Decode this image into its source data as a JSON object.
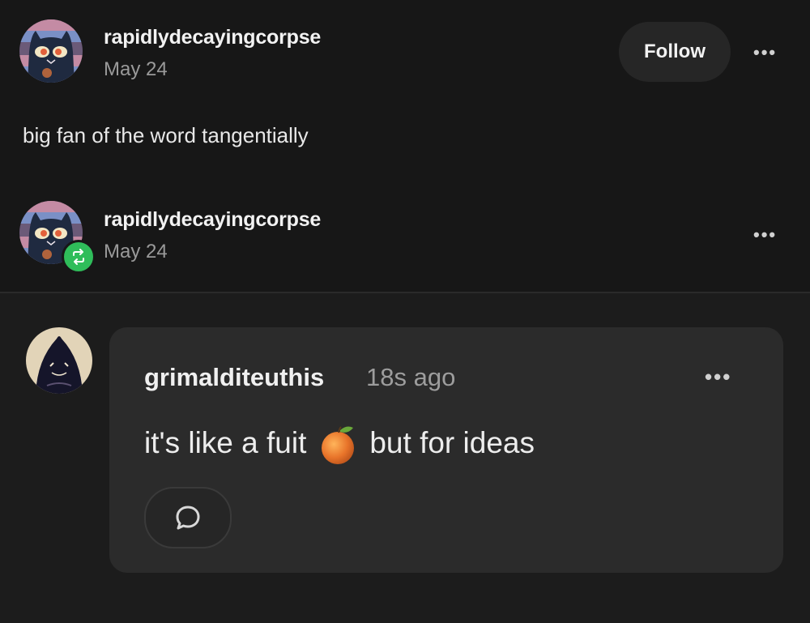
{
  "post": {
    "author": "rapidlydecayingcorpse",
    "date": "May 24",
    "follow_label": "Follow",
    "more_label": "•••",
    "body": "big fan of the word tangentially"
  },
  "reblog": {
    "author": "rapidlydecayingcorpse",
    "date": "May 24",
    "more_label": "•••"
  },
  "reply": {
    "author": "grimalditeuthis",
    "time": "18s ago",
    "more_label": "•••",
    "text_before": "it's like a fuit",
    "emoji": "orange-fruit-icon",
    "text_after": "but for ideas"
  },
  "colors": {
    "background": "#171717",
    "card": "#2b2b2b",
    "reblog_badge": "#2fbd5a"
  }
}
